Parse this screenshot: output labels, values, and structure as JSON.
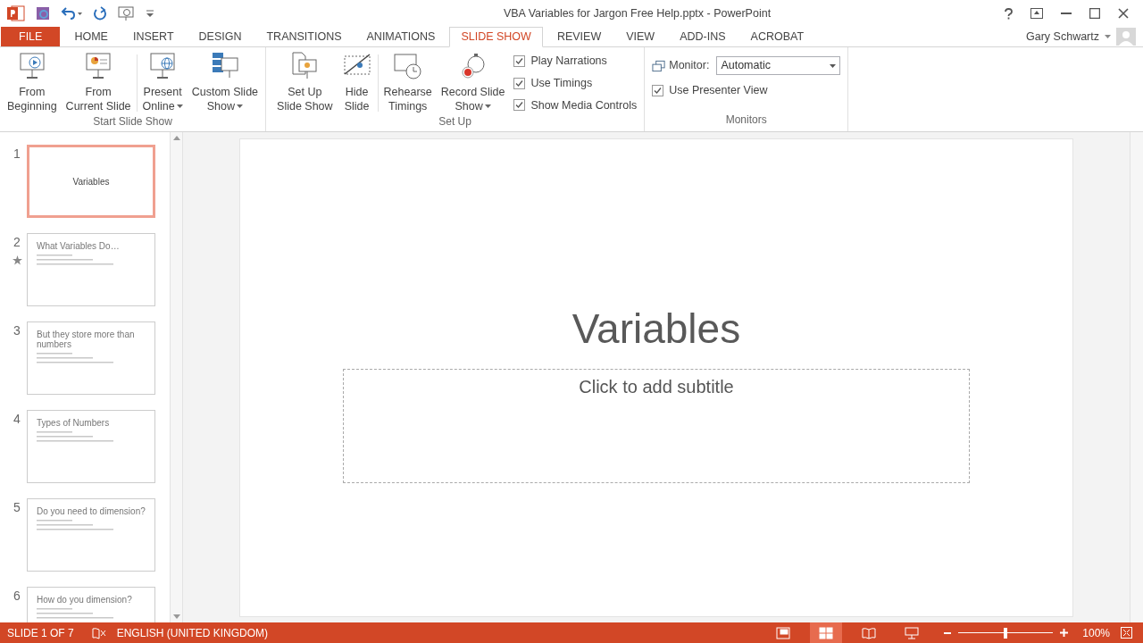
{
  "window": {
    "title": "VBA Variables for Jargon Free Help.pptx - PowerPoint"
  },
  "tabs": [
    {
      "label": "FILE",
      "kind": "file",
      "selected": false
    },
    {
      "label": "HOME",
      "kind": "tab",
      "selected": false
    },
    {
      "label": "INSERT",
      "kind": "tab",
      "selected": false
    },
    {
      "label": "DESIGN",
      "kind": "tab",
      "selected": false
    },
    {
      "label": "TRANSITIONS",
      "kind": "tab",
      "selected": false
    },
    {
      "label": "ANIMATIONS",
      "kind": "tab",
      "selected": false
    },
    {
      "label": "SLIDE SHOW",
      "kind": "tab",
      "selected": true
    },
    {
      "label": "REVIEW",
      "kind": "tab",
      "selected": false
    },
    {
      "label": "VIEW",
      "kind": "tab",
      "selected": false
    },
    {
      "label": "ADD-INS",
      "kind": "tab",
      "selected": false
    },
    {
      "label": "ACROBAT",
      "kind": "tab",
      "selected": false
    }
  ],
  "user": {
    "name": "Gary Schwartz"
  },
  "ribbon": {
    "groups": [
      {
        "label": "Start Slide Show",
        "buttons": [
          {
            "kind": "play",
            "lines": [
              "From",
              "Beginning"
            ],
            "dropdown": false
          },
          {
            "kind": "current",
            "lines": [
              "From",
              "Current Slide"
            ],
            "dropdown": false
          },
          {
            "kind": "globe",
            "lines": [
              "Present",
              "Online"
            ],
            "dropdown": true
          },
          {
            "kind": "custom",
            "lines": [
              "Custom Slide",
              "Show"
            ],
            "dropdown": true
          }
        ]
      },
      {
        "label": "Set Up",
        "buttons": [
          {
            "kind": "setup",
            "lines": [
              "Set Up",
              "Slide Show"
            ],
            "dropdown": false
          },
          {
            "kind": "hide",
            "lines": [
              "Hide",
              "Slide"
            ],
            "dropdown": false
          },
          {
            "kind": "rehearse",
            "lines": [
              "Rehearse",
              "Timings"
            ],
            "dropdown": false
          },
          {
            "kind": "record",
            "lines": [
              "Record Slide",
              "Show"
            ],
            "dropdown": true
          }
        ],
        "checkboxes": [
          {
            "label": "Play Narrations",
            "checked": true
          },
          {
            "label": "Use Timings",
            "checked": true
          },
          {
            "label": "Show Media Controls",
            "checked": true
          }
        ]
      },
      {
        "label": "Monitors",
        "monitor": {
          "label": "Monitor:",
          "value": "Automatic"
        },
        "checkboxes": [
          {
            "label": "Use Presenter View",
            "checked": true
          }
        ]
      }
    ]
  },
  "slides": [
    {
      "number": "1",
      "title": "Variables",
      "kind": "title",
      "selected": true,
      "transition": false
    },
    {
      "number": "2",
      "title": "What Variables Do…",
      "kind": "content",
      "selected": false,
      "transition": true
    },
    {
      "number": "3",
      "title": "But they store more than numbers",
      "kind": "content",
      "selected": false,
      "transition": false
    },
    {
      "number": "4",
      "title": "Types of Numbers",
      "kind": "content",
      "selected": false,
      "transition": false
    },
    {
      "number": "5",
      "title": "Do you need to dimension?",
      "kind": "content",
      "selected": false,
      "transition": false
    },
    {
      "number": "6",
      "title": "How do you dimension?",
      "kind": "content",
      "selected": false,
      "transition": false
    }
  ],
  "slide": {
    "title": "Variables",
    "subtitle_placeholder": "Click to add subtitle"
  },
  "status_bar": {
    "slide": "SLIDE 1 OF 7",
    "language": "ENGLISH (UNITED KINGDOM)",
    "views": [
      {
        "kind": "normal",
        "selected": false
      },
      {
        "kind": "sorter",
        "selected": true
      },
      {
        "kind": "reading",
        "selected": false
      },
      {
        "kind": "show",
        "selected": false
      }
    ],
    "zoom": {
      "level": 0.5,
      "reading": "100%"
    }
  }
}
